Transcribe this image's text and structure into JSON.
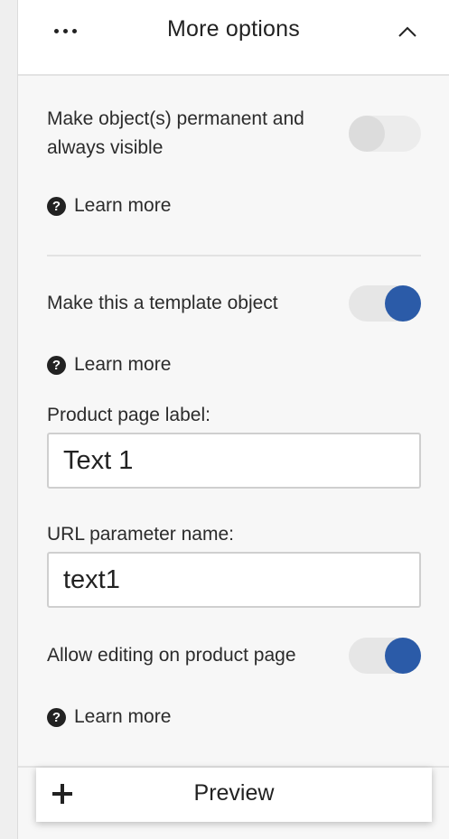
{
  "header": {
    "menu_icon": "more-horizontal-icon",
    "title": "More options",
    "collapse_icon": "chevron-up-icon"
  },
  "permanent": {
    "label": "Make object(s) permanent and always visible",
    "enabled": false,
    "learn_more": "Learn more"
  },
  "template": {
    "label": "Make this a template object",
    "enabled": true,
    "learn_more": "Learn more"
  },
  "product_label": {
    "label": "Product page label:",
    "value": "Text 1"
  },
  "url_param": {
    "label": "URL parameter name:",
    "value": "text1"
  },
  "allow_editing": {
    "label": "Allow editing on product page",
    "enabled": true,
    "learn_more": "Learn more"
  },
  "preview": {
    "label": "Preview",
    "icon": "plus-icon"
  },
  "colors": {
    "accent": "#2b5ba8",
    "toggle_off": "#dcdcdc"
  }
}
